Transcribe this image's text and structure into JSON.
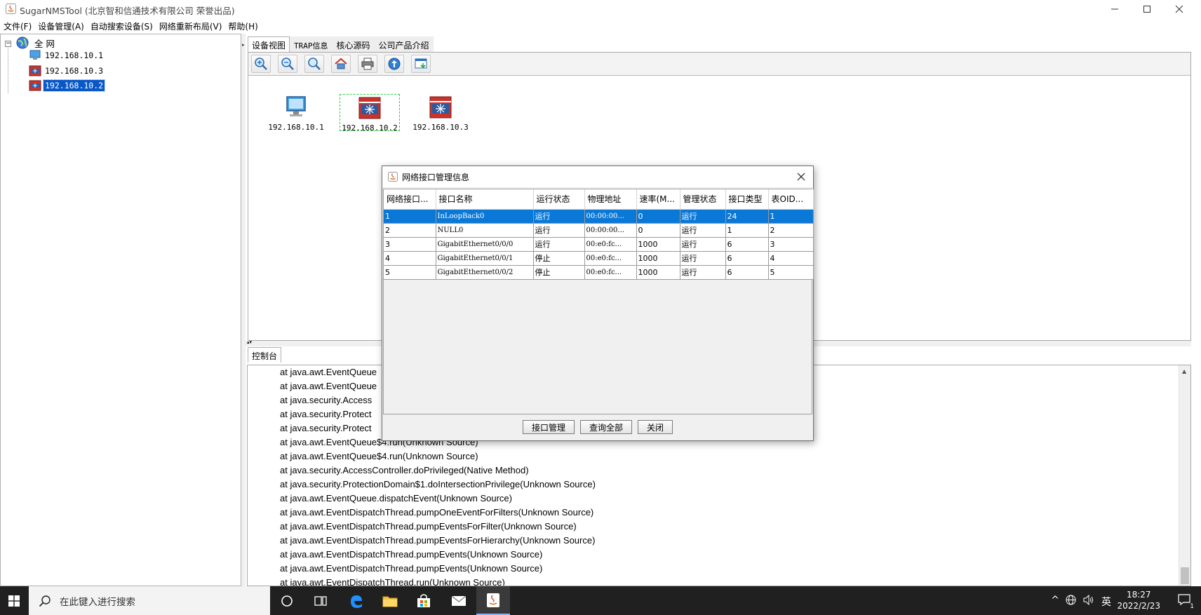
{
  "window": {
    "title": "SugarNMSTool (北京智和信通技术有限公司 荣誉出品)"
  },
  "menubar": [
    {
      "label": "文件(F)"
    },
    {
      "label": "设备管理(A)"
    },
    {
      "label": "自动搜索设备(S)"
    },
    {
      "label": "网络重新布局(V)"
    },
    {
      "label": "帮助(H)"
    }
  ],
  "tree": {
    "root": "全 网",
    "items": [
      {
        "label": "192.168.10.1",
        "icon": "monitor-icon",
        "selected": false
      },
      {
        "label": "192.168.10.3",
        "icon": "switch-icon",
        "selected": false
      },
      {
        "label": "192.168.10.2",
        "icon": "switch-icon",
        "selected": true
      }
    ]
  },
  "tabs": [
    {
      "label": "设备视图",
      "active": true
    },
    {
      "label": "TRAP信息",
      "active": false
    },
    {
      "label": "核心源码",
      "active": false
    },
    {
      "label": "公司产品介绍",
      "active": false
    }
  ],
  "toolbar": [
    {
      "icon": "zoom-in-icon"
    },
    {
      "icon": "zoom-out-icon"
    },
    {
      "icon": "zoom-fit-icon"
    },
    {
      "icon": "home-icon"
    },
    {
      "icon": "print-icon"
    },
    {
      "icon": "refresh-icon"
    },
    {
      "icon": "export-icon"
    }
  ],
  "devices": [
    {
      "label": "192.168.10.1",
      "icon": "monitor-icon",
      "selected": false
    },
    {
      "label": "192.168.10.2",
      "icon": "switch-icon",
      "selected": true
    },
    {
      "label": "192.168.10.3",
      "icon": "switch-icon",
      "selected": false
    }
  ],
  "console": {
    "tab": "控制台",
    "lines": [
      "at java.awt.EventQueue",
      "at java.awt.EventQueue",
      "at java.security.Access",
      "at java.security.Protect",
      "at java.security.Protect",
      "at java.awt.EventQueue$4.run(Unknown Source)",
      "at java.awt.EventQueue$4.run(Unknown Source)",
      "at java.security.AccessController.doPrivileged(Native Method)",
      "at java.security.ProtectionDomain$1.doIntersectionPrivilege(Unknown Source)",
      "at java.awt.EventQueue.dispatchEvent(Unknown Source)",
      "at java.awt.EventDispatchThread.pumpOneEventForFilters(Unknown Source)",
      "at java.awt.EventDispatchThread.pumpEventsForFilter(Unknown Source)",
      "at java.awt.EventDispatchThread.pumpEventsForHierarchy(Unknown Source)",
      "at java.awt.EventDispatchThread.pumpEvents(Unknown Source)",
      "at java.awt.EventDispatchThread.pumpEvents(Unknown Source)",
      "at java.awt.EventDispatchThread.run(Unknown Source)"
    ]
  },
  "dialog": {
    "title": "网络接口管理信息",
    "columns": [
      "网络接口...",
      "接口名称",
      "运行状态",
      "物理地址",
      "速率(M...",
      "管理状态",
      "接口类型",
      "表OID..."
    ],
    "rows": [
      [
        "1",
        "InLoopBack0",
        "运行",
        "00:00:00...",
        "0",
        "运行",
        "24",
        "1"
      ],
      [
        "2",
        "NULL0",
        "运行",
        "00:00:00...",
        "0",
        "运行",
        "1",
        "2"
      ],
      [
        "3",
        "GigabitEthernet0/0/0",
        "运行",
        "00:e0:fc...",
        "1000",
        "运行",
        "6",
        "3"
      ],
      [
        "4",
        "GigabitEthernet0/0/1",
        "停止",
        "00:e0:fc...",
        "1000",
        "运行",
        "6",
        "4"
      ],
      [
        "5",
        "GigabitEthernet0/0/2",
        "停止",
        "00:e0:fc...",
        "1000",
        "运行",
        "6",
        "5"
      ]
    ],
    "selected_row": 0,
    "buttons": [
      {
        "label": "接口管理"
      },
      {
        "label": "查询全部"
      },
      {
        "label": "关闭"
      }
    ]
  },
  "taskbar": {
    "search_placeholder": "在此键入进行搜索",
    "ime": "英",
    "time": "18:27",
    "date": "2022/2/23",
    "notification_count": "1"
  }
}
